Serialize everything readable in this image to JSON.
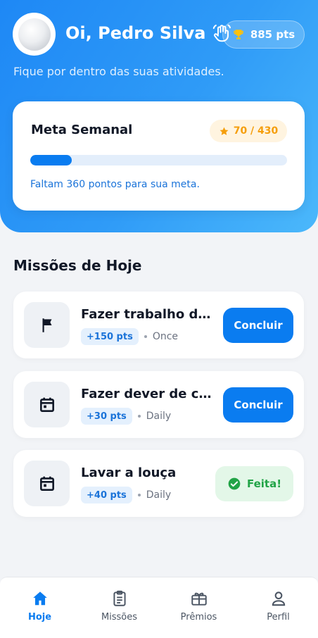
{
  "header": {
    "greeting": "Oi, Pedro Silva",
    "subtitle": "Fique por dentro das suas atividades.",
    "points": "885 pts",
    "wave_icon": "waving-hand-icon",
    "trophy_icon": "trophy-icon"
  },
  "goal": {
    "title": "Meta Semanal",
    "badge": "70 / 430",
    "current": 70,
    "target": 430,
    "progress": 0.163,
    "hint": "Faltam 360 pontos para sua meta."
  },
  "missions": {
    "section_title": "Missões de Hoje",
    "items": [
      {
        "name": "Fazer trabalho de escola",
        "points": "+150 pts",
        "frequency": "Once",
        "icon": "flag-icon",
        "action": "Concluir",
        "done": false
      },
      {
        "name": "Fazer dever de casa",
        "points": "+30 pts",
        "frequency": "Daily",
        "icon": "calendar-icon",
        "action": "Concluir",
        "done": false
      },
      {
        "name": "Lavar a louça",
        "points": "+40 pts",
        "frequency": "Daily",
        "icon": "calendar-icon",
        "action": "Feita!",
        "done": true
      }
    ]
  },
  "nav": {
    "items": [
      {
        "label": "Hoje",
        "icon": "home-icon",
        "active": true
      },
      {
        "label": "Missões",
        "icon": "clipboard-icon",
        "active": false
      },
      {
        "label": "Prêmios",
        "icon": "gift-icon",
        "active": false
      },
      {
        "label": "Perfil",
        "icon": "person-icon",
        "active": false
      }
    ]
  },
  "colors": {
    "primary": "#0a7cf0",
    "header_gradient_start": "#1e88f5",
    "header_gradient_end": "#4bb8fb",
    "success": "#22a447",
    "warning": "#f59e0b"
  }
}
